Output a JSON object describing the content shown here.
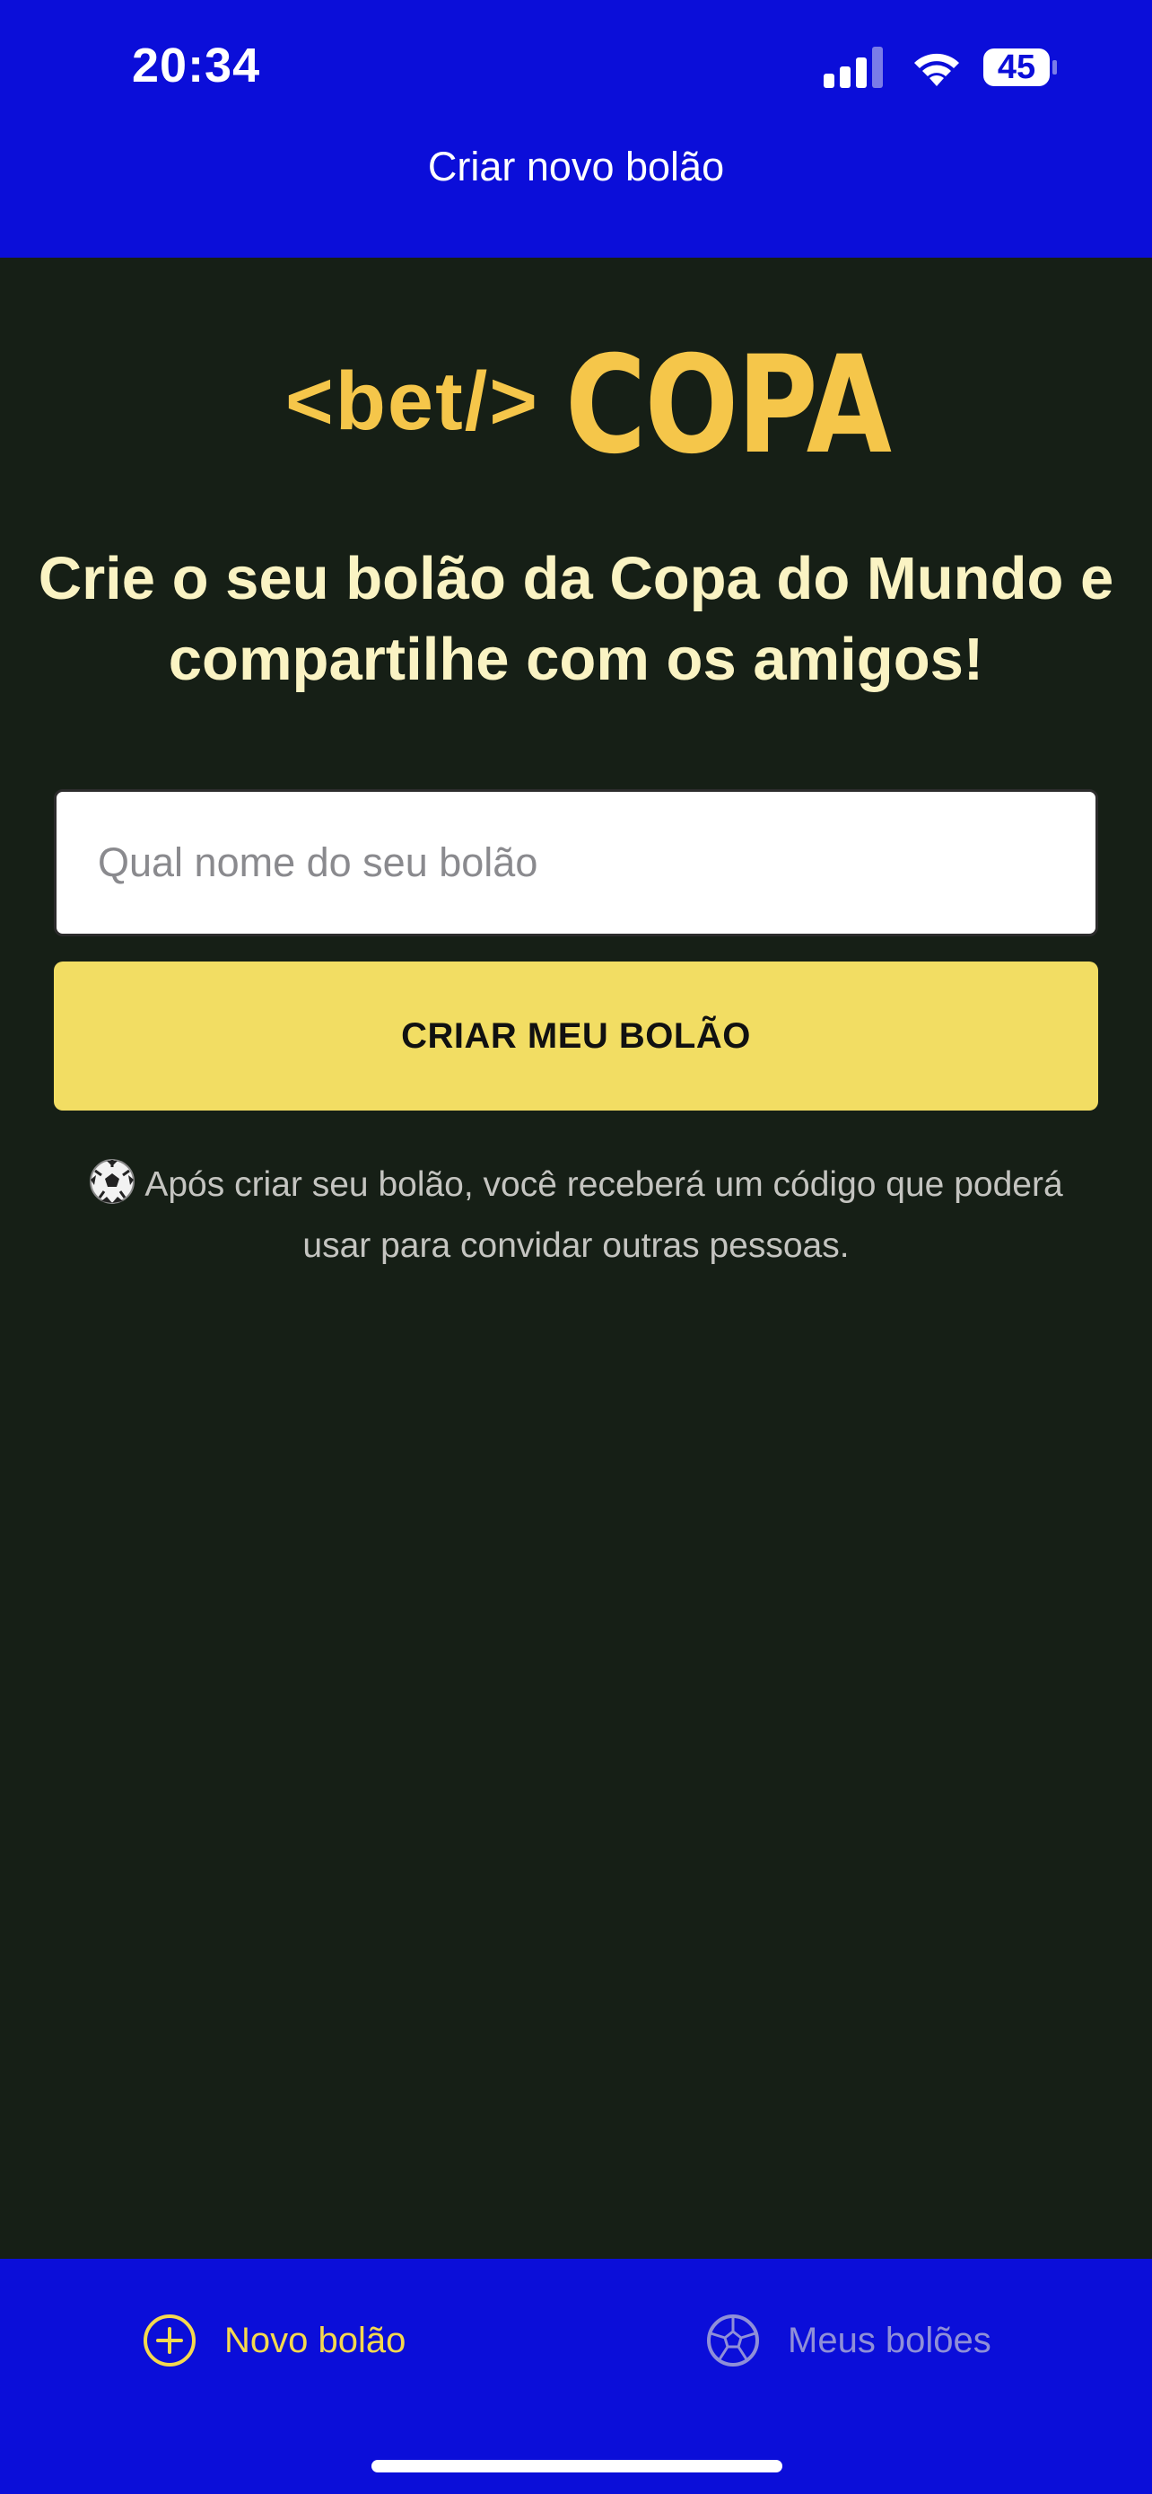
{
  "status_bar": {
    "time": "20:34",
    "battery": "45",
    "icons": [
      "cellular-signal-icon",
      "wifi-icon",
      "battery-icon"
    ]
  },
  "nav": {
    "title": "Criar novo bolão"
  },
  "logo": {
    "prefix": "<bet/>",
    "word": "COPA"
  },
  "headline": "Crie o seu bolão da Copa do Mundo e compartilhe com os amigos!",
  "form": {
    "name_placeholder": "Qual nome do seu bolão",
    "name_value": "",
    "submit_label": "CRIAR MEU BOLÃO"
  },
  "info": {
    "icon": "soccer-ball-icon",
    "text": "Após criar seu bolão, você receberá um código que poderá usar para convidar outras pessoas."
  },
  "tabs": [
    {
      "label": "Novo bolão",
      "icon": "plus-circle-icon",
      "active": true
    },
    {
      "label": "Meus bolões",
      "icon": "soccer-ball-icon",
      "active": false
    }
  ],
  "colors": {
    "brand_blue": "#0B0ED9",
    "background": "#161F16",
    "accent_yellow": "#F2DD63",
    "logo_yellow": "#F5C64A",
    "headline_text": "#FAF3C3"
  }
}
